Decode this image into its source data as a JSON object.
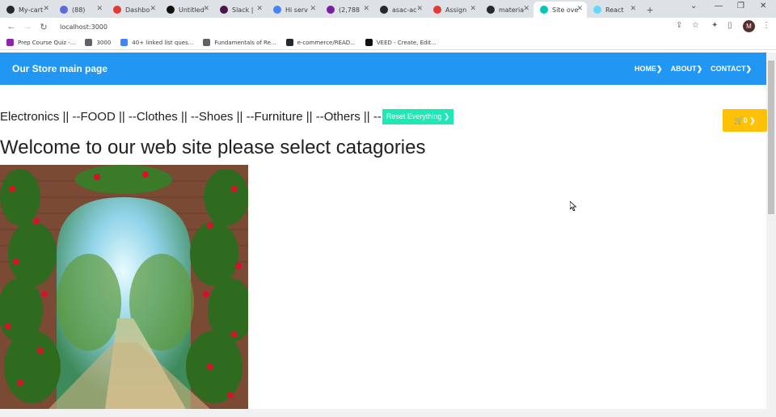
{
  "browser": {
    "tabs": [
      {
        "label": "My-cart",
        "color": "#24292e"
      },
      {
        "label": "(88)",
        "color": "#5b6bde"
      },
      {
        "label": "Dashbo",
        "color": "#e53935"
      },
      {
        "label": "Untitled",
        "color": "#111111"
      },
      {
        "label": "Slack |",
        "color": "#4a154b"
      },
      {
        "label": "Hi serv",
        "color": "#4285f4"
      },
      {
        "label": "(2,788",
        "color": "#7b1fa2"
      },
      {
        "label": "asac-ac",
        "color": "#24292e"
      },
      {
        "label": "Assign",
        "color": "#e53935"
      },
      {
        "label": "materia",
        "color": "#24292e"
      },
      {
        "label": "Site ove",
        "color": "#00c7b7"
      },
      {
        "label": "React",
        "color": "#61dafb"
      }
    ],
    "new_tab": "+",
    "url": "localhost:3000",
    "profile_initial": "M",
    "bookmarks": [
      {
        "label": "Prep Course Quiz -...",
        "color": "#8e24aa"
      },
      {
        "label": "3000",
        "color": "#5f6368"
      },
      {
        "label": "40+ linked list ques...",
        "color": "#4285f4"
      },
      {
        "label": "Fundamentals of Re...",
        "color": "#5f6368"
      },
      {
        "label": "e-commerce/READ...",
        "color": "#24292e"
      },
      {
        "label": "VEED - Create, Edit...",
        "color": "#111111"
      }
    ]
  },
  "navbar": {
    "brand": "Our Store main page",
    "links": [
      "HOME❯",
      "ABOUT❯",
      "CONTACT❯"
    ],
    "color": "#2196f3"
  },
  "categories_text": "Electronics || --FOOD || --Clothes || --Shoes || --Furniture || --Others || --",
  "reset_button": "Reset Everything ❯",
  "cart_button": "🛒0 ❯",
  "welcome": "Welcome to our web site please select catagories",
  "hero_image": "garden-archway-image"
}
